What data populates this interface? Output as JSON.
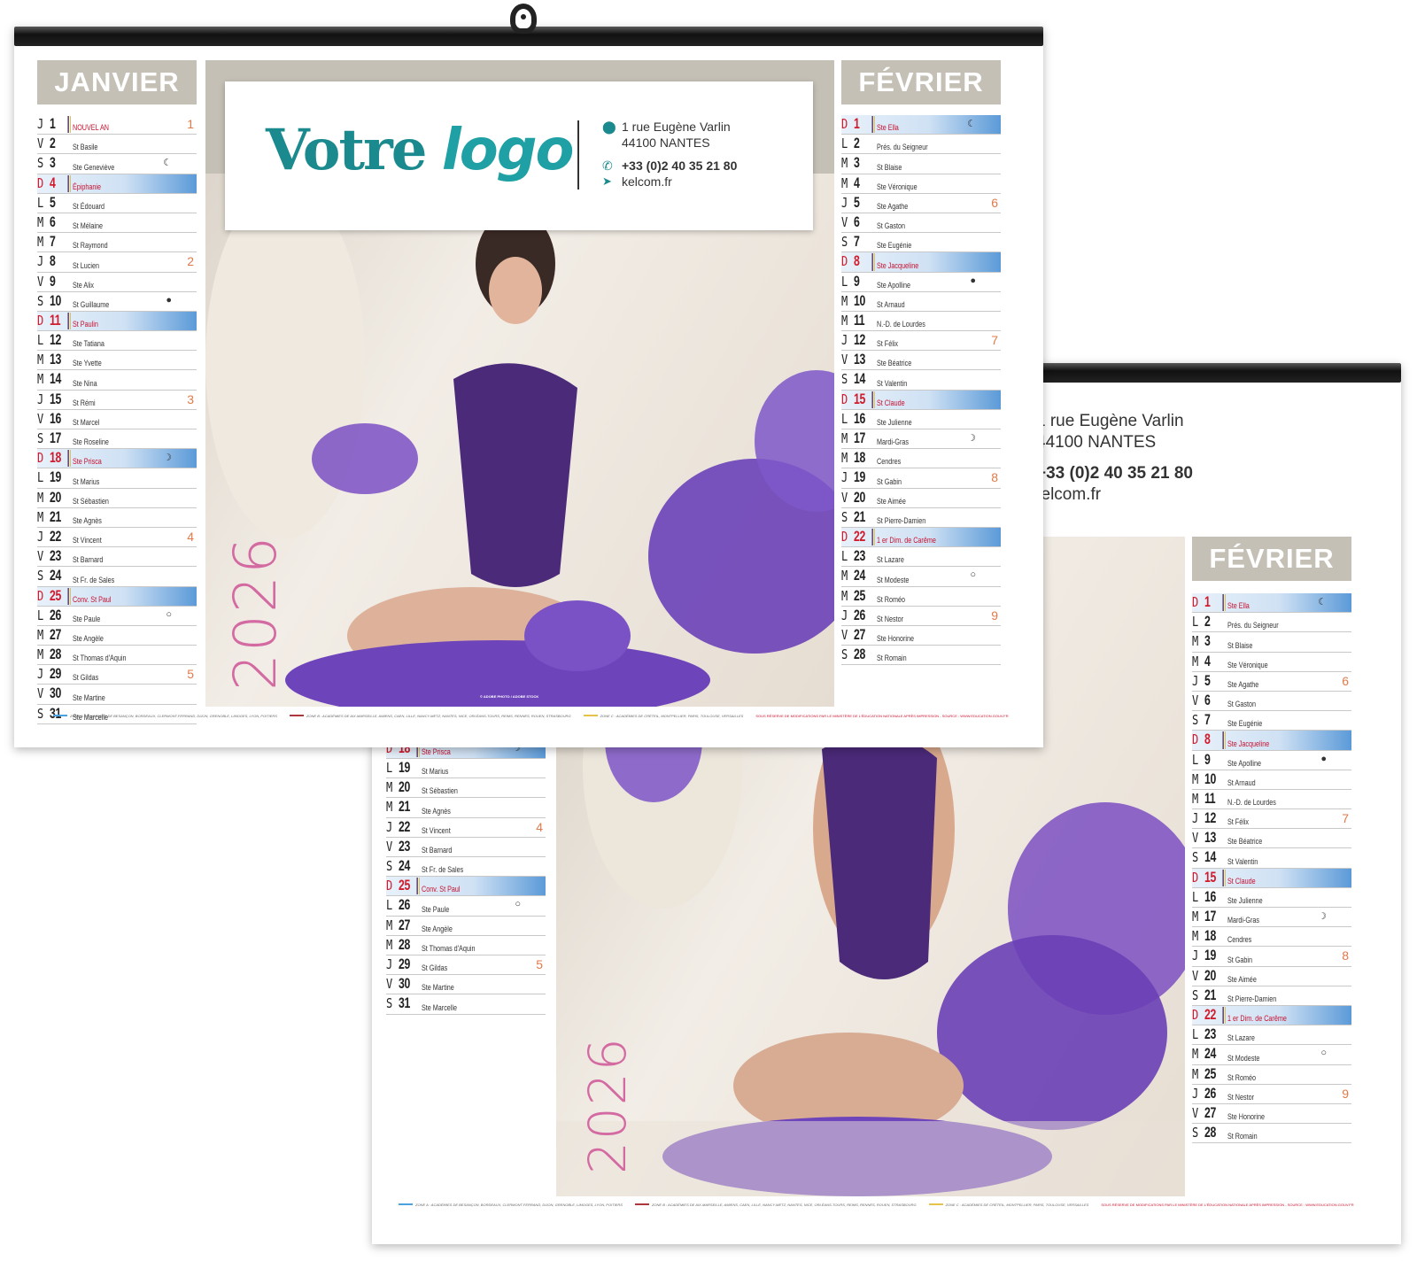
{
  "company": {
    "logo_text_1": "Votre",
    "logo_text_2": "logo",
    "address_line1": "1 rue Eugène Varlin",
    "address_line2": "44100 NANTES",
    "phone": "+33 (0)2 40 35 21 80",
    "website": "kelcom.fr"
  },
  "calendar": {
    "year": "2026",
    "photo_credit": "© ADOBE PHOTO / ADOBE STOCK",
    "colors": {
      "header_bg": "#c5c0b6",
      "sunday_red": "#d21b2c",
      "sunday_blue": "#5b9ad8",
      "week_number": "#e07a4a",
      "year_pink": "#d46aa2",
      "logo_teal": "#1b8a8e"
    },
    "footer": {
      "zone_a": "ZONE A : ACADÉMIES DE BESANÇON, BORDEAUX, CLERMONT-FERRAND, DIJON, GRENOBLE, LIMOGES, LYON, POITIERS",
      "zone_b": "ZONE B : ACADÉMIES DE AIX-MARSEILLE, AMIENS, CAEN, LILLE, NANCY-METZ, NANTES, NICE, ORLÉANS-TOURS, REIMS, RENNES, ROUEN, STRASBOURG",
      "zone_c": "ZONE C : ACADÉMIES DE CRÉTEIL, MONTPELLIER, PARIS, TOULOUSE, VERSAILLES",
      "notice": "SOUS RÉSERVE DE MODIFICATIONS PAR LE MINISTÈRE DE L'ÉDUCATION NATIONALE APRÈS IMPRESSION - SOURCE : WWW.EDUCATION.GOUV.FR",
      "colors": {
        "a": "#4aa3df",
        "b": "#b0363d",
        "c": "#e6c24a"
      }
    },
    "january": {
      "name": "JANVIER",
      "days": [
        {
          "l": "J",
          "n": "1",
          "s": "NOUVEL AN",
          "w": "1",
          "holiday": true
        },
        {
          "l": "V",
          "n": "2",
          "s": "St Basile"
        },
        {
          "l": "S",
          "n": "3",
          "s": "Ste Geneviève",
          "m": "☾"
        },
        {
          "l": "D",
          "n": "4",
          "s": "Épiphanie",
          "sun": true
        },
        {
          "l": "L",
          "n": "5",
          "s": "St Édouard"
        },
        {
          "l": "M",
          "n": "6",
          "s": "St Mélaine"
        },
        {
          "l": "M",
          "n": "7",
          "s": "St Raymond"
        },
        {
          "l": "J",
          "n": "8",
          "s": "St Lucien",
          "w": "2"
        },
        {
          "l": "V",
          "n": "9",
          "s": "Ste Alix"
        },
        {
          "l": "S",
          "n": "10",
          "s": "St Guillaume",
          "m": "●"
        },
        {
          "l": "D",
          "n": "11",
          "s": "St Paulin",
          "sun": true
        },
        {
          "l": "L",
          "n": "12",
          "s": "Ste Tatiana"
        },
        {
          "l": "M",
          "n": "13",
          "s": "Ste Yvette"
        },
        {
          "l": "M",
          "n": "14",
          "s": "Ste Nina"
        },
        {
          "l": "J",
          "n": "15",
          "s": "St Rémi",
          "w": "3"
        },
        {
          "l": "V",
          "n": "16",
          "s": "St Marcel"
        },
        {
          "l": "S",
          "n": "17",
          "s": "Ste Roseline"
        },
        {
          "l": "D",
          "n": "18",
          "s": "Ste Prisca",
          "sun": true,
          "m": "☽"
        },
        {
          "l": "L",
          "n": "19",
          "s": "St Marius"
        },
        {
          "l": "M",
          "n": "20",
          "s": "St Sébastien"
        },
        {
          "l": "M",
          "n": "21",
          "s": "Ste Agnès"
        },
        {
          "l": "J",
          "n": "22",
          "s": "St Vincent",
          "w": "4"
        },
        {
          "l": "V",
          "n": "23",
          "s": "St Barnard"
        },
        {
          "l": "S",
          "n": "24",
          "s": "St Fr. de Sales"
        },
        {
          "l": "D",
          "n": "25",
          "s": "Conv. St Paul",
          "sun": true
        },
        {
          "l": "L",
          "n": "26",
          "s": "Ste Paule",
          "m": "○"
        },
        {
          "l": "M",
          "n": "27",
          "s": "Ste Angèle"
        },
        {
          "l": "M",
          "n": "28",
          "s": "St Thomas d'Aquin"
        },
        {
          "l": "J",
          "n": "29",
          "s": "St Gildas",
          "w": "5"
        },
        {
          "l": "V",
          "n": "30",
          "s": "Ste Martine"
        },
        {
          "l": "S",
          "n": "31",
          "s": "Ste Marcelle"
        }
      ]
    },
    "february": {
      "name": "FÉVRIER",
      "days": [
        {
          "l": "D",
          "n": "1",
          "s": "Ste Ella",
          "sun": true,
          "m": "☾"
        },
        {
          "l": "L",
          "n": "2",
          "s": "Prés. du Seigneur"
        },
        {
          "l": "M",
          "n": "3",
          "s": "St Blaise"
        },
        {
          "l": "M",
          "n": "4",
          "s": "Ste Véronique"
        },
        {
          "l": "J",
          "n": "5",
          "s": "Ste Agathe",
          "w": "6"
        },
        {
          "l": "V",
          "n": "6",
          "s": "St Gaston"
        },
        {
          "l": "S",
          "n": "7",
          "s": "Ste Eugénie"
        },
        {
          "l": "D",
          "n": "8",
          "s": "Ste Jacqueline",
          "sun": true
        },
        {
          "l": "L",
          "n": "9",
          "s": "Ste Apolline",
          "m": "●"
        },
        {
          "l": "M",
          "n": "10",
          "s": "St Arnaud"
        },
        {
          "l": "M",
          "n": "11",
          "s": "N.-D. de Lourdes"
        },
        {
          "l": "J",
          "n": "12",
          "s": "St Félix",
          "w": "7"
        },
        {
          "l": "V",
          "n": "13",
          "s": "Ste Béatrice"
        },
        {
          "l": "S",
          "n": "14",
          "s": "St Valentin"
        },
        {
          "l": "D",
          "n": "15",
          "s": "St Claude",
          "sun": true
        },
        {
          "l": "L",
          "n": "16",
          "s": "Ste Julienne"
        },
        {
          "l": "M",
          "n": "17",
          "s": "Mardi-Gras",
          "m": "☽"
        },
        {
          "l": "M",
          "n": "18",
          "s": "Cendres"
        },
        {
          "l": "J",
          "n": "19",
          "s": "St Gabin",
          "w": "8"
        },
        {
          "l": "V",
          "n": "20",
          "s": "Ste Aimée"
        },
        {
          "l": "S",
          "n": "21",
          "s": "St Pierre-Damien"
        },
        {
          "l": "D",
          "n": "22",
          "s": "1 er Dim. de Carême",
          "sun": true
        },
        {
          "l": "L",
          "n": "23",
          "s": "St Lazare"
        },
        {
          "l": "M",
          "n": "24",
          "s": "St Modeste",
          "m": "○"
        },
        {
          "l": "M",
          "n": "25",
          "s": "St Roméo"
        },
        {
          "l": "J",
          "n": "26",
          "s": "St Nestor",
          "w": "9"
        },
        {
          "l": "V",
          "n": "27",
          "s": "Ste Honorine"
        },
        {
          "l": "S",
          "n": "28",
          "s": "St Romain"
        }
      ]
    }
  }
}
